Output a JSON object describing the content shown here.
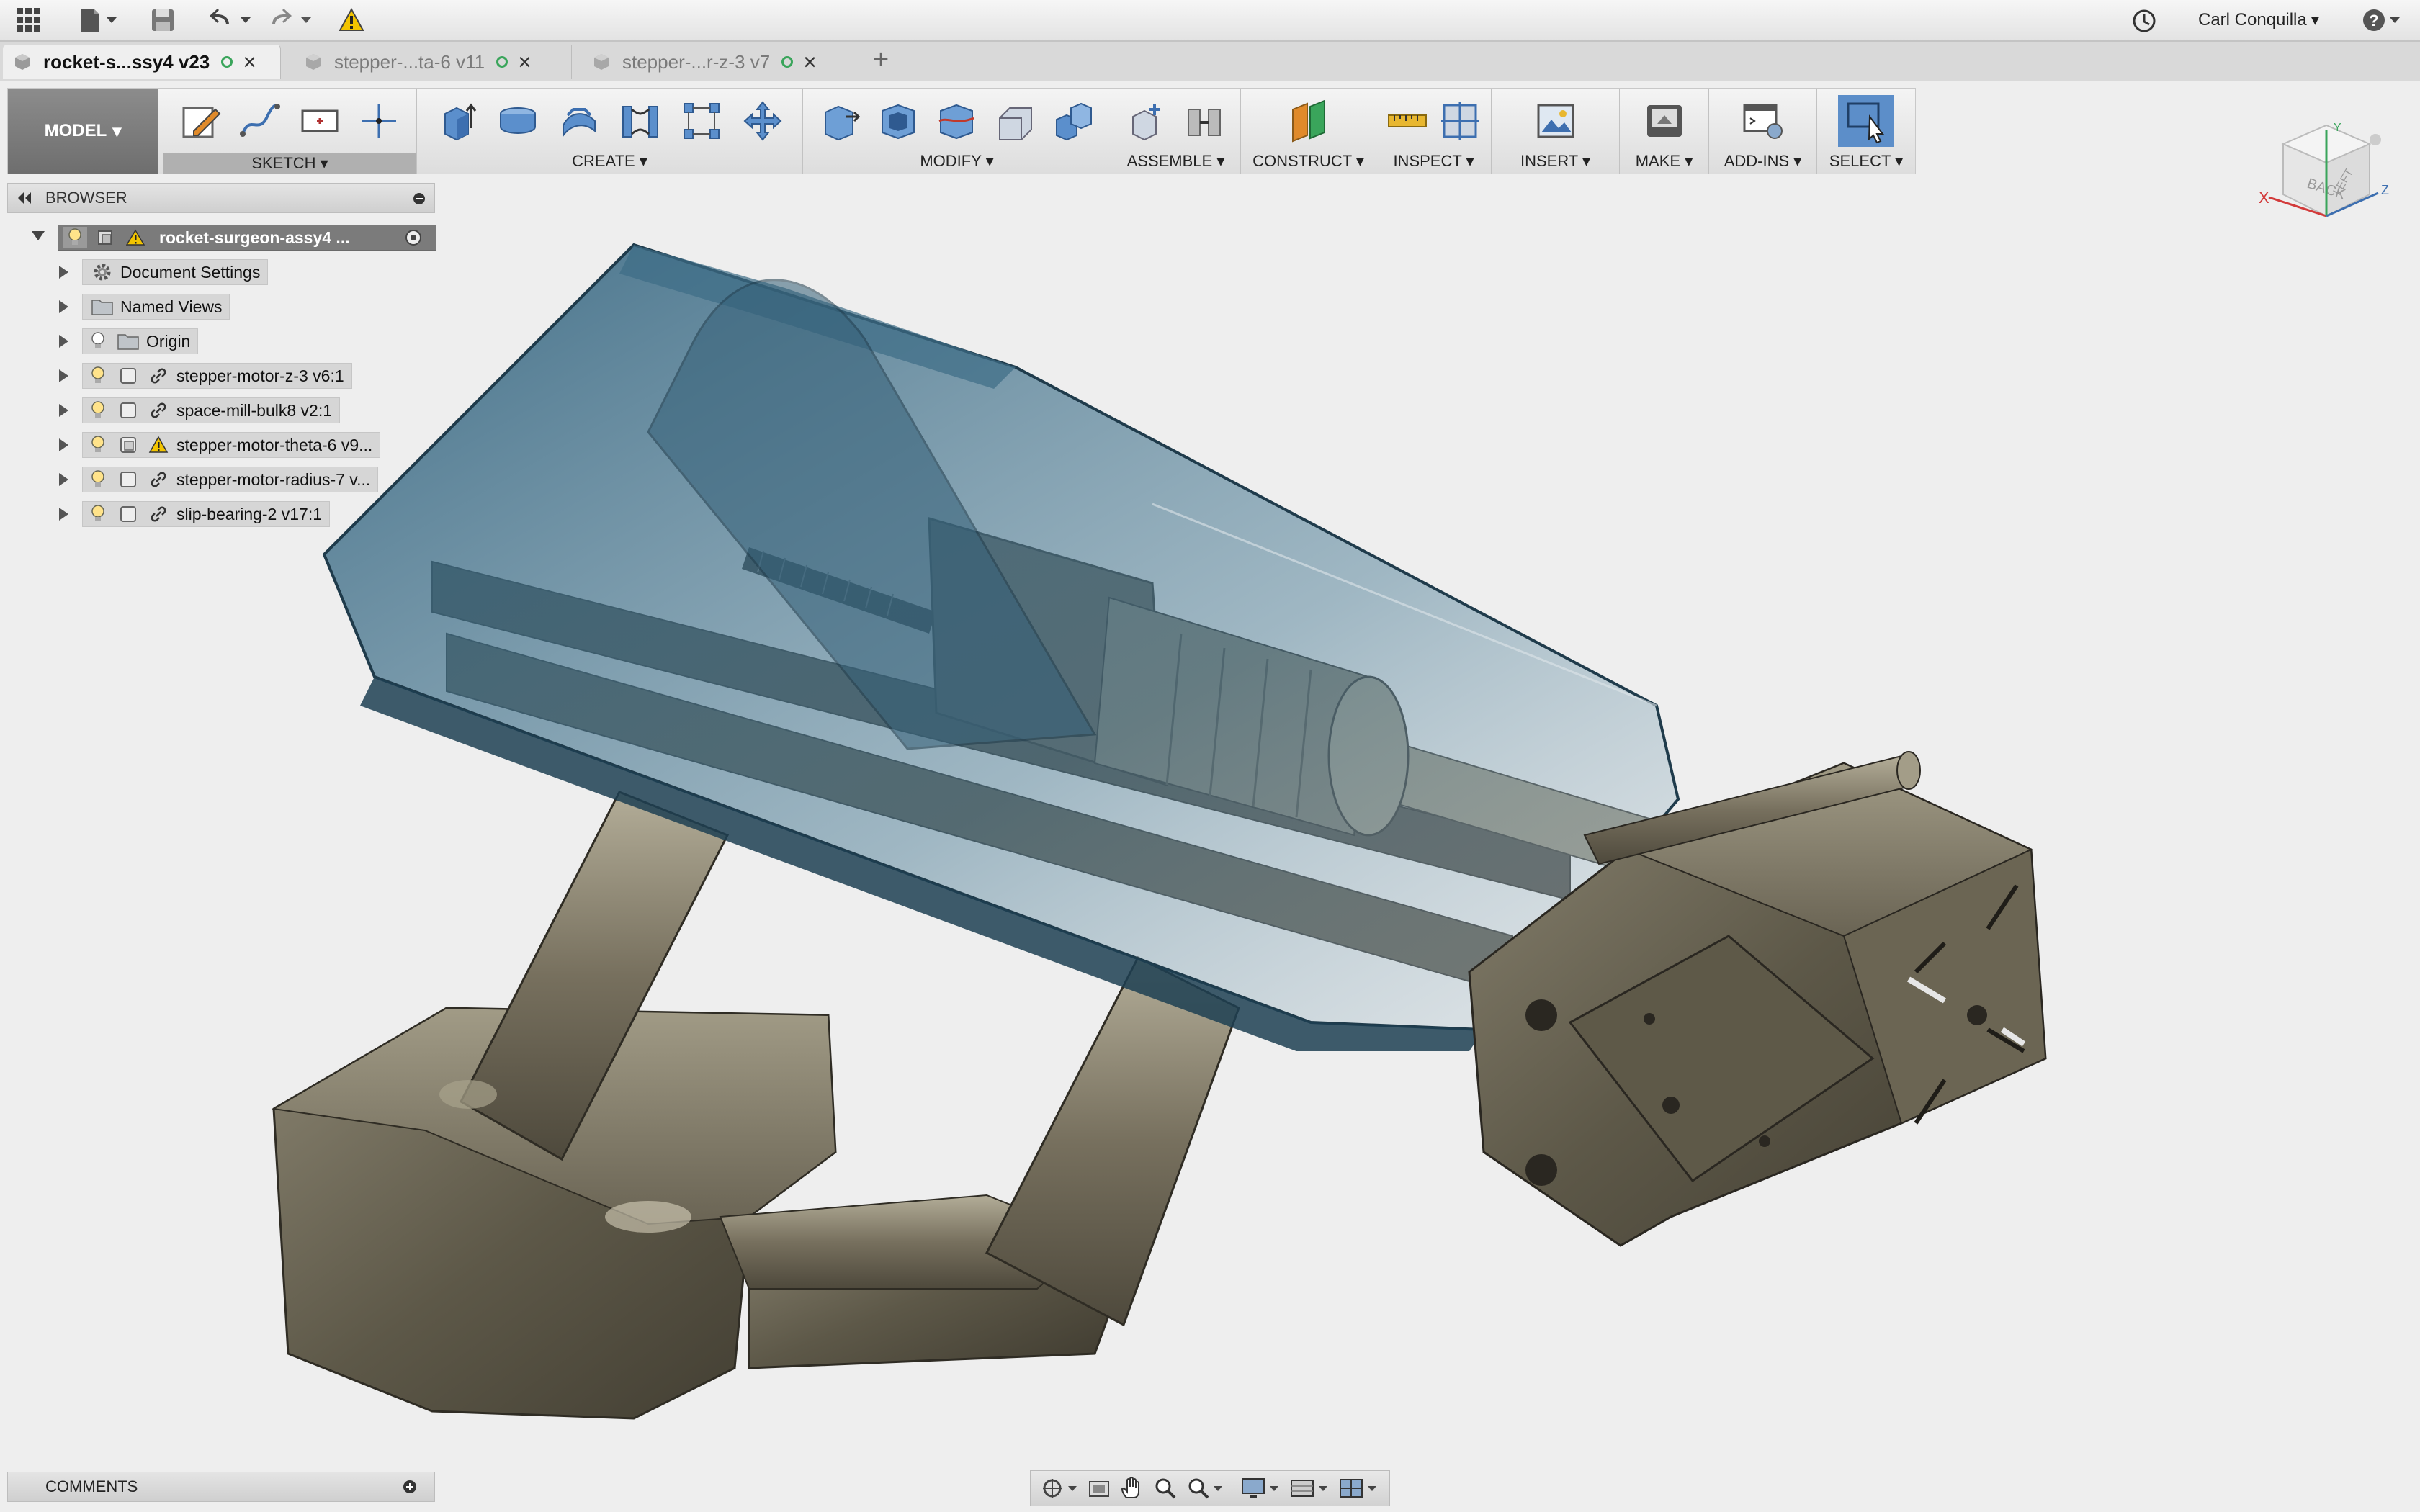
{
  "app": {
    "user_name": "Carl Conquilla",
    "help_label": "?"
  },
  "tabs": [
    {
      "label": "rocket-s...ssy4 v23",
      "active": true
    },
    {
      "label": "stepper-...ta-6 v11",
      "active": false
    },
    {
      "label": "stepper-...r-z-3 v7",
      "active": false
    }
  ],
  "toolbar": {
    "workspace": "MODEL",
    "groups": {
      "sketch": "SKETCH",
      "create": "CREATE",
      "modify": "MODIFY",
      "assemble": "ASSEMBLE",
      "construct": "CONSTRUCT",
      "inspect": "INSPECT",
      "insert": "INSERT",
      "make": "MAKE",
      "addins": "ADD-INS",
      "select": "SELECT"
    }
  },
  "browser": {
    "title": "BROWSER",
    "root": "rocket-surgeon-assy4 ...",
    "items": [
      {
        "label": "Document Settings",
        "icon": "gear-icon"
      },
      {
        "label": "Named Views",
        "icon": "folder-icon"
      },
      {
        "label": "Origin",
        "icon": "folder-icon"
      },
      {
        "label": "stepper-motor-z-3 v6:1",
        "icon": "link-icon"
      },
      {
        "label": "space-mill-bulk8 v2:1",
        "icon": "link-icon"
      },
      {
        "label": "stepper-motor-theta-6 v9...",
        "icon": "warning-icon"
      },
      {
        "label": "stepper-motor-radius-7 v...",
        "icon": "link-icon"
      },
      {
        "label": "slip-bearing-2 v17:1",
        "icon": "link-icon"
      }
    ]
  },
  "comments": {
    "title": "COMMENTS"
  },
  "viewcube": {
    "face_top": "BACK",
    "face_side": "LEFT",
    "axis_x": "X",
    "axis_y": "Y",
    "axis_z": "Z"
  },
  "colors": {
    "accent": "#3d7ab8",
    "select_active": "#5c8ec9",
    "body_metal": "#6f6a5a",
    "shell_glass": "#2f5f78"
  }
}
